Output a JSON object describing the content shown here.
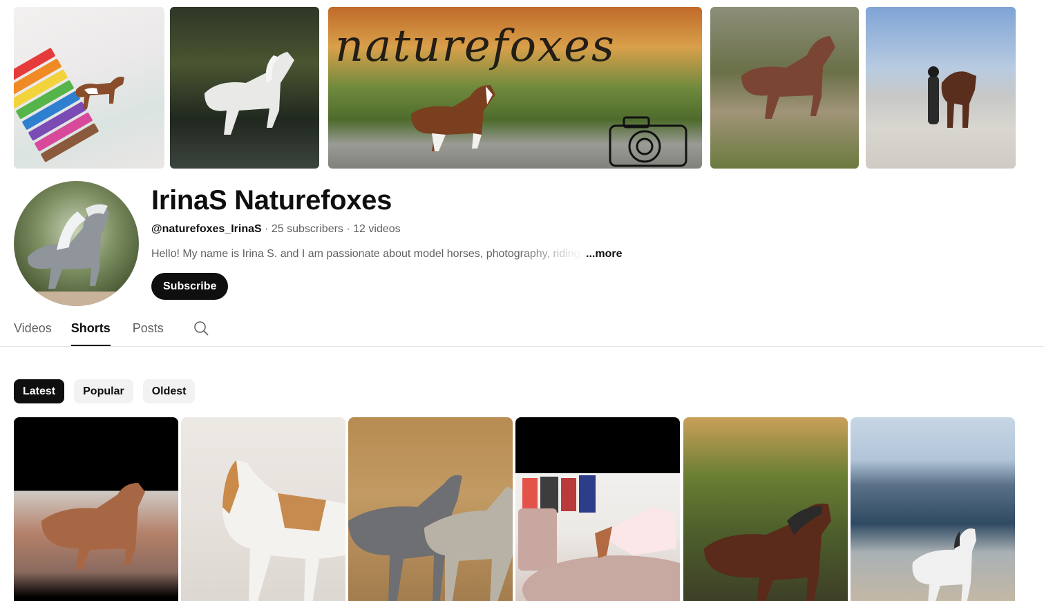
{
  "banner": {
    "script_text": "naturefoxes"
  },
  "channel": {
    "name": "IrinaS Naturefoxes",
    "handle": "@naturefoxes_IrinaS",
    "meta_sep1": " · ",
    "subscribers": "25 subscribers",
    "meta_sep2": " · ",
    "videos": "12 videos",
    "description": "Hello! My name is Irina S. and I am passionate about model horses, photography, riding, a",
    "more_label": "...more",
    "subscribe_label": "Subscribe"
  },
  "tabs": {
    "items": [
      {
        "label": "Videos",
        "active": false
      },
      {
        "label": "Shorts",
        "active": true
      },
      {
        "label": "Posts",
        "active": false
      }
    ],
    "search_icon": "search-icon"
  },
  "filters": {
    "chips": [
      {
        "label": "Latest",
        "active": true
      },
      {
        "label": "Popular",
        "active": false
      },
      {
        "label": "Oldest",
        "active": false
      }
    ]
  },
  "colors": {
    "text_primary": "#0f0f0f",
    "text_secondary": "#606060",
    "chip_bg": "#f2f2f2",
    "chip_active_bg": "#0f0f0f",
    "divider": "#e5e5e5"
  }
}
